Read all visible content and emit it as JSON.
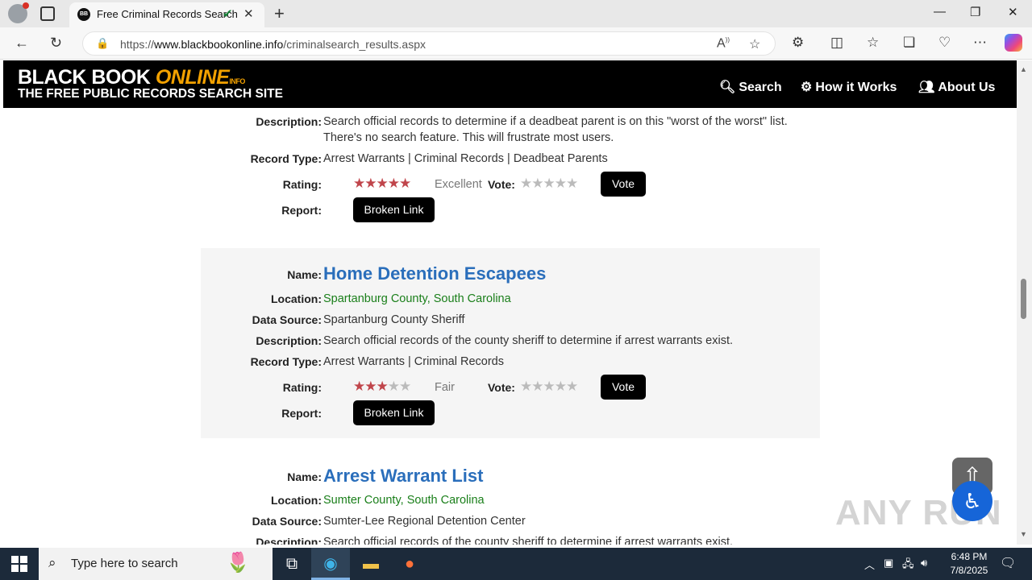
{
  "browser": {
    "tab_title": "Free Criminal Records Search",
    "url_prefix": "https://",
    "url_domain": "www.blackbookonline.info",
    "url_path": "/criminalsearch_results.aspx"
  },
  "header": {
    "logo_black_book": "BLACK BOOK ",
    "logo_online": "ONLINE",
    "logo_info": "INFO",
    "tagline": "THE FREE PUBLIC RECORDS SEARCH SITE",
    "nav": [
      "Search",
      "How it Works",
      "About Us"
    ]
  },
  "labels": {
    "name": "Name:",
    "location": "Location:",
    "data_source": "Data Source:",
    "description": "Description:",
    "record_type": "Record Type:",
    "rating": "Rating:",
    "vote": "Vote:",
    "report": "Report:",
    "vote_button": "Vote",
    "broken_link": "Broken Link"
  },
  "records": [
    {
      "description_line1": "Search official records to determine if a deadbeat parent is on this \"worst of the worst\" list.",
      "description_line2": "There's no search feature. This will frustrate most users.",
      "record_type": "Arrest Warrants | Criminal Records | Deadbeat Parents",
      "rating": 5,
      "rating_word": "Excellent"
    },
    {
      "name": "Home Detention Escapees",
      "location": "Spartanburg County, South Carolina",
      "data_source": "Spartanburg County Sheriff",
      "description": "Search official records of the county sheriff to determine if arrest warrants exist.",
      "record_type": "Arrest Warrants | Criminal Records",
      "rating": 3,
      "rating_word": "Fair"
    },
    {
      "name": "Arrest Warrant List",
      "location": "Sumter County, South Carolina",
      "data_source": "Sumter-Lee Regional Detention Center",
      "description": "Search official records of the county sheriff to determine if arrest warrants exist."
    }
  ],
  "watermark": "ANY RUN",
  "taskbar": {
    "search_placeholder": "Type here to search",
    "time": "6:48 PM",
    "date": "7/8/2025"
  }
}
